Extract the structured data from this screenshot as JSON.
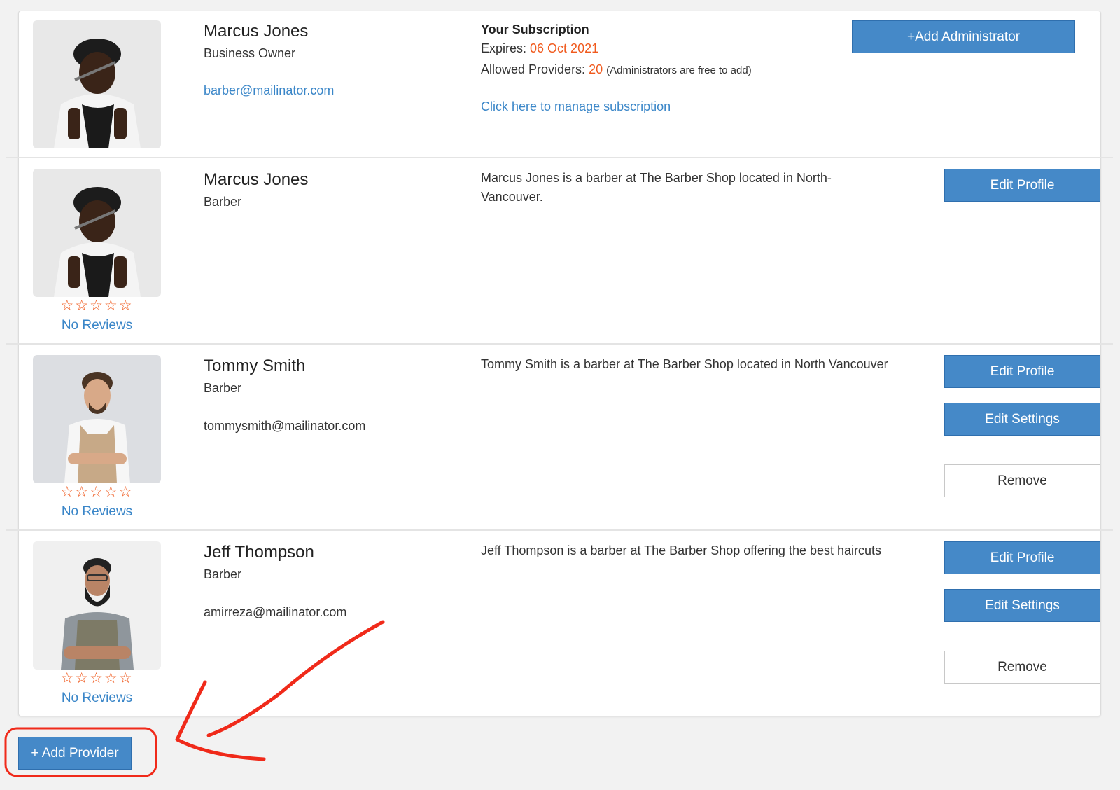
{
  "owner": {
    "name": "Marcus Jones",
    "role": "Business Owner",
    "email": "barber@mailinator.com",
    "subscription": {
      "title": "Your Subscription",
      "expires_label": "Expires: ",
      "expires_value": "06 Oct 2021",
      "allowed_label": "Allowed Providers: ",
      "allowed_value": "20",
      "allowed_note": "(Administrators are free to add)",
      "manage_link": "Click here to manage subscription"
    },
    "add_admin_label": "+Add Administrator"
  },
  "providers": [
    {
      "name": "Marcus Jones",
      "role": "Barber",
      "email": "",
      "bio": "Marcus Jones is a barber at The Barber Shop located in North-Vancouver.",
      "rating": 0,
      "max_rating": 5,
      "stars": "☆☆☆☆☆",
      "reviews_label": "No Reviews",
      "buttons": {
        "edit_profile": "Edit Profile"
      }
    },
    {
      "name": "Tommy Smith",
      "role": "Barber",
      "email": "tommysmith@mailinator.com",
      "bio": "Tommy Smith is a barber at The Barber Shop located in North Vancouver",
      "rating": 0,
      "max_rating": 5,
      "stars": "☆☆☆☆☆",
      "reviews_label": "No Reviews",
      "buttons": {
        "edit_profile": "Edit Profile",
        "edit_settings": "Edit Settings",
        "remove": "Remove"
      }
    },
    {
      "name": "Jeff Thompson",
      "role": "Barber",
      "email": "amirreza@mailinator.com",
      "bio": "Jeff Thompson is a barber at The Barber Shop offering the best haircuts",
      "rating": 0,
      "max_rating": 5,
      "stars": "☆☆☆☆☆",
      "reviews_label": "No Reviews",
      "buttons": {
        "edit_profile": "Edit Profile",
        "edit_settings": "Edit Settings",
        "remove": "Remove"
      }
    }
  ],
  "add_provider_label": "+ Add Provider",
  "colors": {
    "primary": "#4589c8",
    "link": "#3a86c8",
    "accent": "#f05a1e",
    "annotation": "#f02a1a"
  }
}
